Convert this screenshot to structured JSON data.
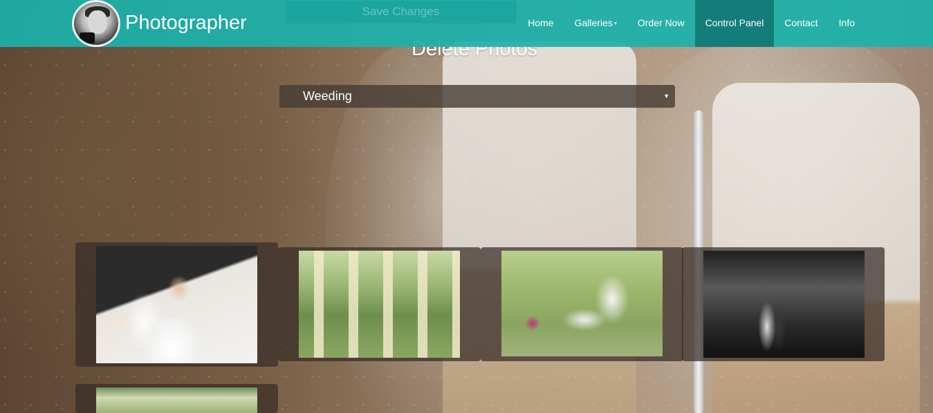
{
  "navbar": {
    "brand": "Photographer",
    "save_button": "Save Changes",
    "items": [
      {
        "label": "Home",
        "active": false,
        "dropdown": false
      },
      {
        "label": "Galleries",
        "active": false,
        "dropdown": true
      },
      {
        "label": "Order Now",
        "active": false,
        "dropdown": false
      },
      {
        "label": "Control Panel",
        "active": true,
        "dropdown": false
      },
      {
        "label": "Contact",
        "active": false,
        "dropdown": false
      },
      {
        "label": "Info",
        "active": false,
        "dropdown": false
      }
    ],
    "caret_icon": "▾"
  },
  "main": {
    "title": "Delete Photos",
    "gallery_select": {
      "value": "Weeding",
      "arrow_icon": "▼"
    },
    "photos": [
      {
        "icon": "wedding-photo"
      },
      {
        "icon": "wedding-photo"
      },
      {
        "icon": "wedding-photo"
      },
      {
        "icon": "wedding-photo"
      },
      {
        "icon": "wedding-photo"
      }
    ]
  },
  "colors": {
    "navbar": "#1ab2aa",
    "nav_active": "#147873",
    "card": "#372d28"
  }
}
